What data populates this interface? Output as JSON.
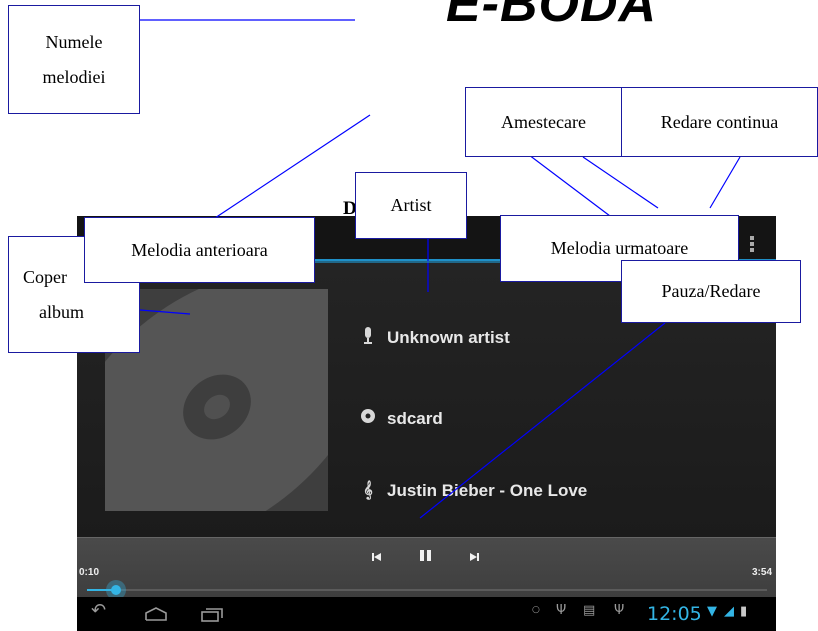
{
  "logo": "E-BODA",
  "heading_fragment": "D",
  "callouts": {
    "song_name": [
      "Numele",
      "melodiei"
    ],
    "shuffle": "Amestecare",
    "repeat": "Redare continua",
    "artist": "Artist",
    "previous": "Melodia anterioara",
    "next": "Melodia urmatoare",
    "album_cover": [
      "Coper",
      "album"
    ],
    "play_pause": "Pauza/Redare"
  },
  "player": {
    "artist": "Unknown artist",
    "album": "sdcard",
    "title": "Justin Bieber - One Love",
    "elapsed": "0:10",
    "duration": "3:54",
    "progress": 0.043,
    "clock": "12:05",
    "icons": {
      "artist": "microphone-icon",
      "album": "disc-icon",
      "title": "music-note-icon",
      "prev": "skip-previous-icon",
      "pause": "pause-icon",
      "next": "skip-next-icon",
      "back": "back-icon",
      "home": "home-icon",
      "recents": "recent-apps-icon",
      "menu": "overflow-menu-icon"
    }
  },
  "colors": {
    "callout_border": "#1a1aa0",
    "leader_line": "#0000ff",
    "accent": "#33b5e5"
  }
}
